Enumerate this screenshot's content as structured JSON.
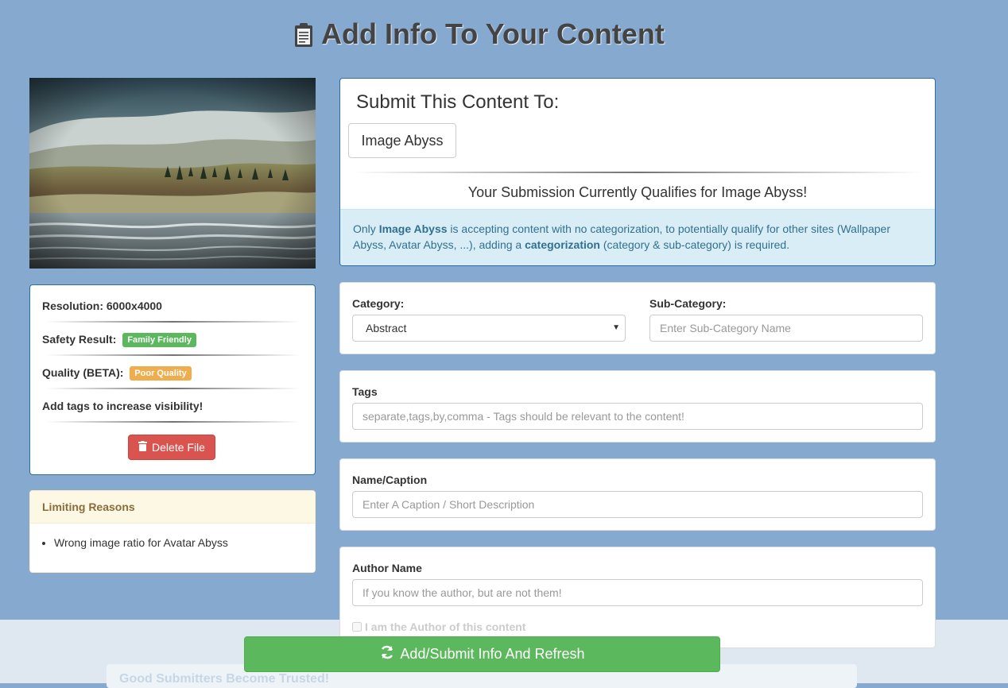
{
  "header": {
    "title": "Add Info To Your Content",
    "icon": "clipboard-icon"
  },
  "file_info": {
    "resolution_label": "Resolution:",
    "resolution_value": "6000x4000",
    "safety_label": "Safety Result:",
    "safety_badge": "Family Friendly",
    "quality_label": "Quality (BETA):",
    "quality_badge": "Poor Quality",
    "tags_hint": "Add tags to increase visibility!",
    "delete_label": "Delete File"
  },
  "limiting": {
    "title": "Limiting Reasons",
    "items": [
      "Wrong image ratio for Avatar Abyss"
    ]
  },
  "submit_to": {
    "title": "Submit This Content To:",
    "site_button": "Image Abyss",
    "qualifies_text": "Your Submission Currently Qualifies for Image Abyss!",
    "info_part1": "Only ",
    "info_bold1": "Image Abyss",
    "info_part2": " is accepting content with no categorization, to potentially qualify for other sites (Wallpaper Abyss, Avatar Abyss, ...), adding a ",
    "info_bold2": "categorization",
    "info_part3": " (category & sub-category) is required."
  },
  "form": {
    "category_label": "Category:",
    "category_value": "Abstract",
    "subcategory_label": "Sub-Category:",
    "subcategory_placeholder": "Enter Sub-Category Name",
    "tags_label": "Tags",
    "tags_placeholder": "separate,tags,by,comma - Tags should be relevant to the content!",
    "caption_label": "Name/Caption",
    "caption_placeholder": "Enter A Caption / Short Description",
    "author_label": "Author Name",
    "author_placeholder": "If you know the author, but are not them!",
    "author_checkbox": "I am the Author of this content"
  },
  "actions": {
    "submit_label": "Add/Submit Info And Refresh"
  },
  "footer": {
    "trusted_text": "Good Submitters Become Trusted!"
  },
  "colors": {
    "background": "#86a9cf",
    "primary_border": "#2e6da4",
    "success": "#5cb85c",
    "danger": "#d9534f",
    "warning": "#f0ad4e"
  }
}
